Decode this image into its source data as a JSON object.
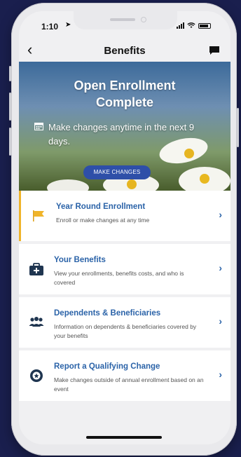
{
  "status_bar": {
    "time": "1:10"
  },
  "navbar": {
    "title": "Benefits",
    "back_icon": "chevron-left-icon",
    "chat_icon": "chat-icon"
  },
  "hero": {
    "title_line1": "Open Enrollment",
    "title_line2": "Complete",
    "subtitle": "Make changes anytime in the next 9 days.",
    "button_label": "MAKE CHANGES"
  },
  "items": [
    {
      "title": "Year Round Enrollment",
      "description": "Enroll or make changes at any time",
      "icon": "flag-icon",
      "active": true
    },
    {
      "title": "Your Benefits",
      "description": "View your enrollments, benefits costs, and who is covered",
      "icon": "medical-kit-icon",
      "active": false
    },
    {
      "title": "Dependents & Beneficiaries",
      "description": "Information on dependents & beneficiaries covered by your benefits",
      "icon": "people-icon",
      "active": false
    },
    {
      "title": "Report a Qualifying Change",
      "description": "Make changes outside of annual enrollment based on an event",
      "icon": "badge-icon",
      "active": false
    }
  ],
  "colors": {
    "accent": "#2b63a8",
    "active_bar": "#f0b429",
    "button": "#2e4fa8",
    "background": "#1a1f4e"
  }
}
